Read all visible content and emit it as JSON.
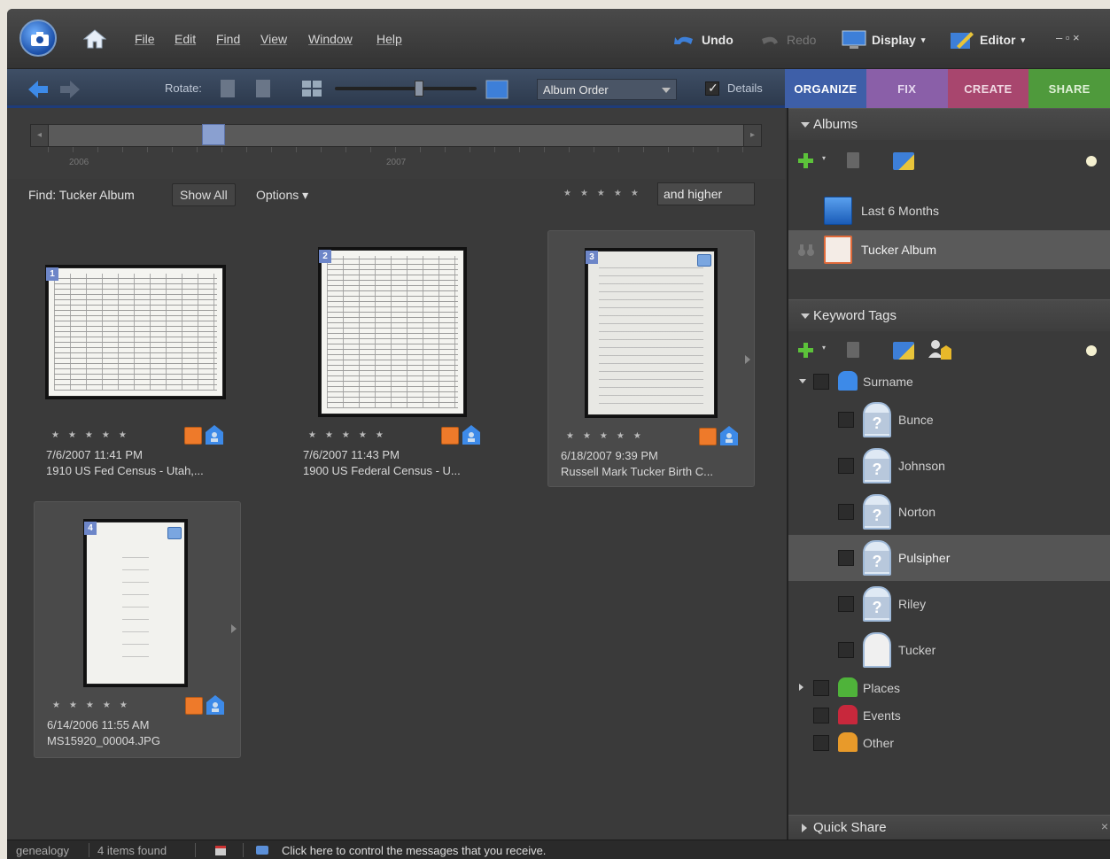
{
  "menubar": {
    "items": [
      "File",
      "Edit",
      "Find",
      "View",
      "Window",
      "Help"
    ],
    "undo": "Undo",
    "redo": "Redo",
    "display": "Display",
    "editor": "Editor",
    "window_controls": "– ▫ ×"
  },
  "toolbar": {
    "rotate_label": "Rotate:",
    "sort_value": "Album Order",
    "details_label": "Details",
    "details_checked": true
  },
  "tabs": [
    {
      "label": "ORGANIZE",
      "color": "#3e5fa8",
      "text": "#ffffff"
    },
    {
      "label": "FIX",
      "color": "#8a5fa8",
      "text": "#e6d8f0"
    },
    {
      "label": "CREATE",
      "color": "#a8466e",
      "text": "#f0d8e2"
    },
    {
      "label": "SHARE",
      "color": "#4f9a3c",
      "text": "#def0d6"
    }
  ],
  "timeline": {
    "years": [
      "2006",
      "2007"
    ]
  },
  "findbar": {
    "find_label": "Find: Tucker Album",
    "show_all": "Show All",
    "options": "Options ▾",
    "rating_filter": "and higher",
    "stars": "★★★★★"
  },
  "photos": [
    {
      "num": "1",
      "date": "7/6/2007 11:41 PM",
      "name": "1910 US Fed Census - Utah,...",
      "stars": "★★★★★"
    },
    {
      "num": "2",
      "date": "7/6/2007 11:43 PM",
      "name": "1900 US Federal Census - U...",
      "stars": "★★★★★"
    },
    {
      "num": "3",
      "date": "6/18/2007 9:39 PM",
      "name": "Russell Mark Tucker Birth C...",
      "stars": "★★★★★"
    },
    {
      "num": "4",
      "date": "6/14/2006 11:55 AM",
      "name": "MS15920_00004.JPG",
      "stars": "★★★★★"
    }
  ],
  "panel": {
    "albums_title": "Albums",
    "albums": [
      {
        "label": "Last 6 Months"
      },
      {
        "label": "Tucker Album"
      }
    ],
    "keywords_title": "Keyword Tags",
    "surname": "Surname",
    "surnames": [
      "Bunce",
      "Johnson",
      "Norton",
      "Pulsipher",
      "Riley",
      "Tucker"
    ],
    "categories": [
      {
        "label": "Places",
        "color": "#4fb33a"
      },
      {
        "label": "Events",
        "color": "#c8283c"
      },
      {
        "label": "Other",
        "color": "#e89a2a"
      }
    ],
    "quickshare_title": "Quick Share"
  },
  "statusbar": {
    "catalog": "genealogy",
    "count": "4 items found",
    "message": "Click here to control the messages that you receive."
  }
}
